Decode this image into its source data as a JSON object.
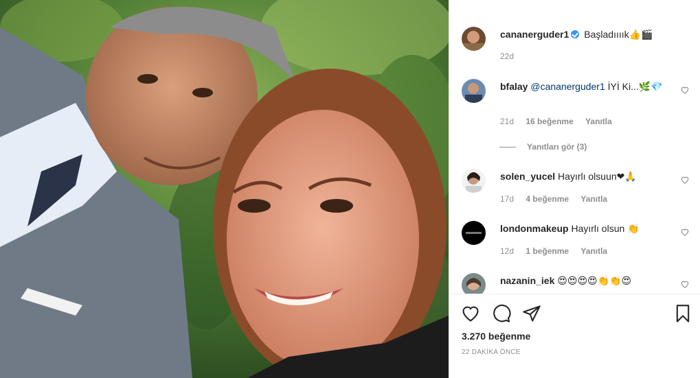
{
  "post": {
    "author": "cananerguder1",
    "caption": "Başladıııık",
    "caption_emoji": "👍🎬",
    "caption_time": "22d"
  },
  "comments": [
    {
      "username": "bfalay",
      "mention": "@cananerguder1",
      "text": "İYİ Ki...",
      "emoji": "🌿💎",
      "time": "21d",
      "likes": "16 beğenme",
      "reply": "Yanıtla",
      "view_replies": "Yanıtları gör (3)"
    },
    {
      "username": "solen_yucel",
      "text": "Hayırlı olsuun",
      "emoji": "❤🙏",
      "time": "17d",
      "likes": "4 beğenme",
      "reply": "Yanıtla"
    },
    {
      "username": "londonmakeup",
      "text": "Hayırlı olsun",
      "emoji": "👏",
      "time": "12d",
      "likes": "1 beğenme",
      "reply": "Yanıtla"
    },
    {
      "username": "nazanin_iek",
      "emoji": "😍😍😍😍👏👏😍"
    }
  ],
  "footer": {
    "like_count": "3.270 beğenme",
    "posted": "22 DAKİKA ÖNCE"
  },
  "icons": {
    "like": "heart-icon",
    "comment": "comment-icon",
    "share": "share-icon",
    "save": "bookmark-icon",
    "comment_like": "heart-small-icon"
  },
  "colors": {
    "text": "#262626",
    "secondary": "#8e8e8e",
    "link": "#00376b",
    "verified": "#3897f0"
  }
}
